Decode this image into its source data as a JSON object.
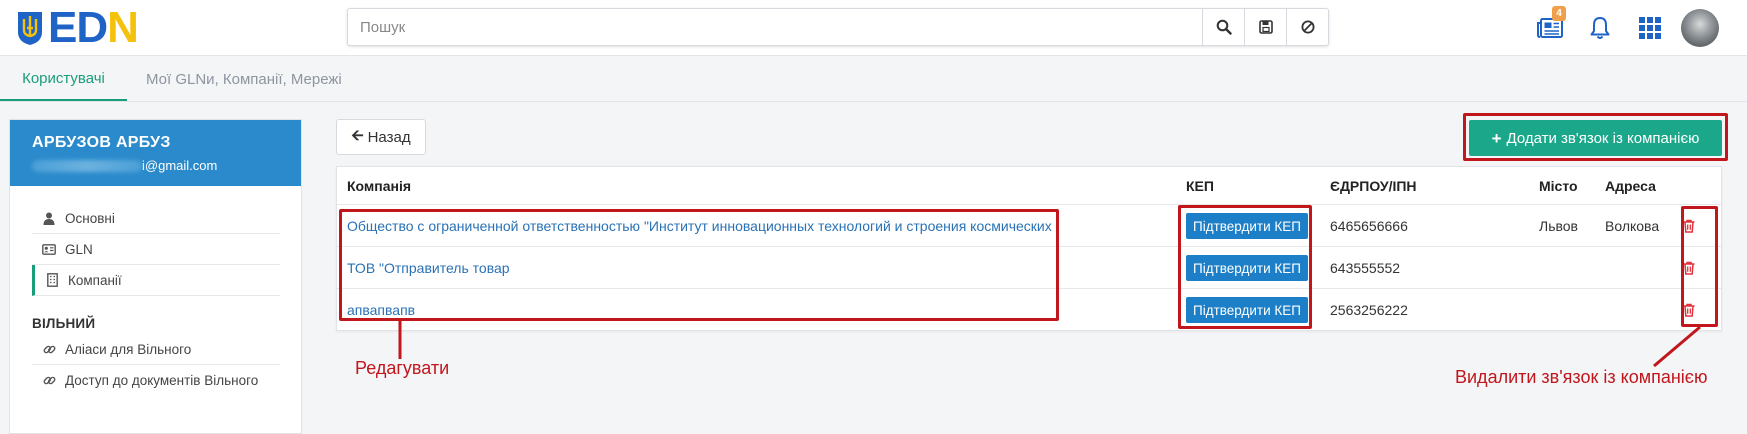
{
  "header": {
    "logo": {
      "text_ed": "ED",
      "text_n": "N",
      "flag": "trident-flag-icon"
    },
    "search": {
      "placeholder": "Пошук",
      "value": ""
    },
    "search_buttons": [
      "search-icon",
      "save-icon",
      "ban-icon"
    ],
    "icons": {
      "news": "newspaper-icon",
      "news_badge": "4",
      "notifications": "bell-icon",
      "apps": "grid-icon",
      "avatar": "avatar"
    }
  },
  "tabs": [
    {
      "label": "Користувачі",
      "active": true
    },
    {
      "label": "Мої GLNи, Компанії, Мережі",
      "active": false
    }
  ],
  "sidebar": {
    "user_name": "АРБУЗОВ АРБУЗ",
    "user_email_suffix": "i@gmail.com",
    "items": [
      {
        "label": "Основні",
        "icon": "user-icon"
      },
      {
        "label": "GLN",
        "icon": "id-card-icon"
      },
      {
        "label": "Компанії",
        "icon": "building-icon",
        "active": true
      }
    ],
    "section_title": "ВІЛЬНИЙ",
    "section_items": [
      {
        "label": "Аліаси для Вільного",
        "icon": "link-icon"
      },
      {
        "label": "Доступ до документів Вільного",
        "icon": "link-icon"
      }
    ]
  },
  "main": {
    "back_label": "Назад",
    "add_label": "Додати зв'язок із компанією",
    "table": {
      "headers": {
        "company": "Компанія",
        "kep": "КЕП",
        "edrpou": "ЄДРПОУ/ІПН",
        "city": "Місто",
        "address": "Адреса"
      },
      "rows": [
        {
          "company": "Общество с ограниченной ответственностью \"Институт инновационных технологий и строения космических",
          "kep": "Підтвердити КЕП",
          "edrpou": "6465656666",
          "city": "Львов",
          "address": "Волкова"
        },
        {
          "company": "ТОВ \"Отправитель товар",
          "kep": "Підтвердити КЕП",
          "edrpou": "643555552",
          "city": "",
          "address": ""
        },
        {
          "company": "апвапвапв",
          "kep": "Підтвердити КЕП",
          "edrpou": "2563256222",
          "city": "",
          "address": ""
        }
      ]
    }
  },
  "annotations": {
    "edit": "Редагувати",
    "delete": "Видалити зв'язок із компанією",
    "color": "#c0161c"
  },
  "colors": {
    "accent": "#1a9e7a",
    "add_button": "#1ba88a",
    "kep_button": "#1c7fc7",
    "user_card": "#2b8acb",
    "link": "#2a72b5",
    "trash": "#e0333b"
  }
}
